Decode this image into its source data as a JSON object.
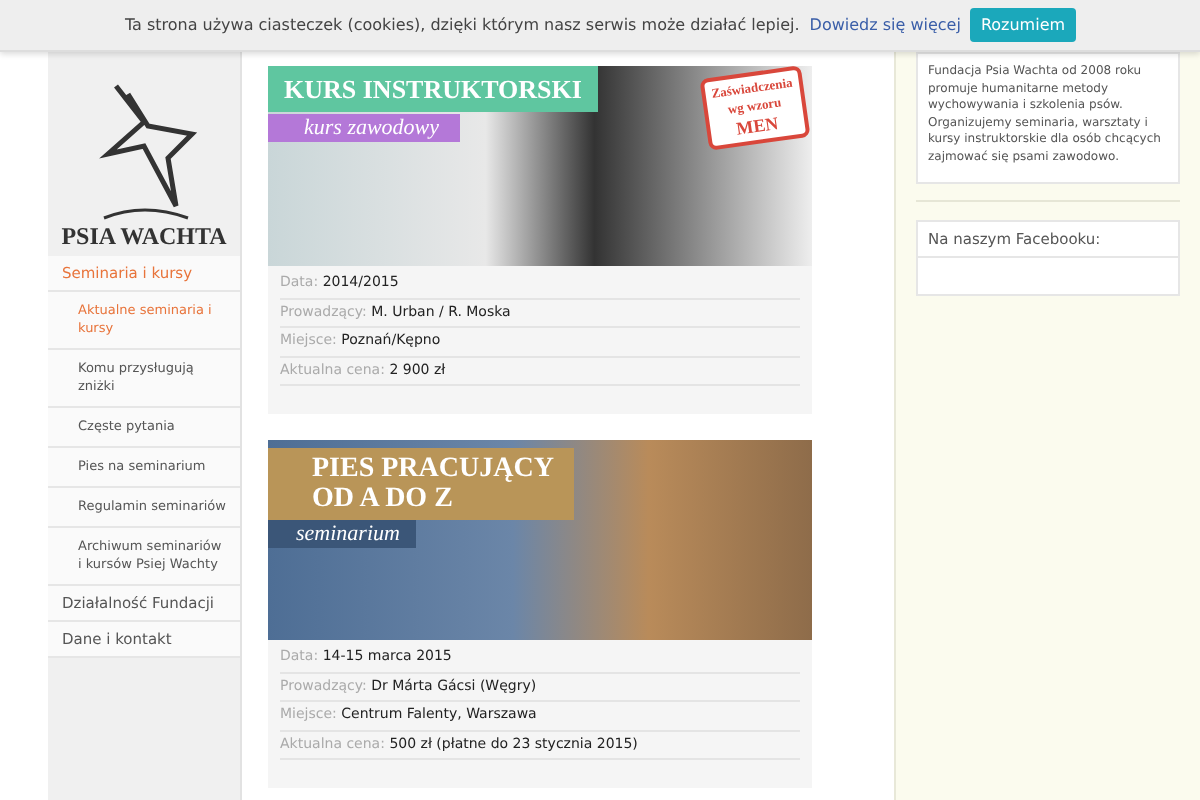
{
  "cookie_bar": {
    "text": "Ta strona używa ciasteczek (cookies), dzięki którym nasz serwis może działać lepiej.",
    "link": "Dowiedz się więcej",
    "button": "Rozumiem"
  },
  "logo": {
    "text": "PSIA WACHTA"
  },
  "sidebar": {
    "items": [
      {
        "label": "Seminaria i kursy",
        "selected": true,
        "children": [
          {
            "label": "Aktualne seminaria i kursy",
            "selected": true
          },
          {
            "label": "Komu przysługują zniżki",
            "selected": false
          },
          {
            "label": "Częste pytania",
            "selected": false
          },
          {
            "label": "Pies na seminarium",
            "selected": false
          },
          {
            "label": "Regulamin seminariów",
            "selected": false
          },
          {
            "label": "Archiwum seminariów i kursów Psiej Wachty",
            "selected": false
          }
        ]
      },
      {
        "label": "Działalność Fundacji",
        "selected": false
      },
      {
        "label": "Dane i kontakt",
        "selected": false
      }
    ]
  },
  "events": [
    {
      "banner": {
        "kind": "course",
        "title": "KURS INSTRUKTORSKI",
        "subtitle": "kurs zawodowy",
        "stamp": [
          "Zaświadczenia",
          "wg wzoru",
          "MEN"
        ]
      },
      "fields": [
        {
          "label": "Data:",
          "value": "2014/2015"
        },
        {
          "label": "Prowadzący:",
          "value": "M. Urban / R. Moska"
        },
        {
          "label": "Miejsce:",
          "value": "Poznań/Kępno"
        },
        {
          "label": "Aktualna cena:",
          "value": "2 900 zł"
        }
      ]
    },
    {
      "banner": {
        "kind": "seminar",
        "title": "PIES PRACUJĄCY",
        "title2": "OD A DO Z",
        "subtitle": "seminarium"
      },
      "fields": [
        {
          "label": "Data:",
          "value": "14-15 marca 2015"
        },
        {
          "label": "Prowadzący:",
          "value": "Dr Márta Gácsi (Węgry)"
        },
        {
          "label": "Miejsce:",
          "value": "Centrum Falenty, Warszawa"
        },
        {
          "label": "Aktualna cena:",
          "value": "500 zł (płatne do 23 stycznia 2015)"
        }
      ]
    }
  ],
  "right": {
    "about": "Fundacja Psia Wachta od 2008 roku promuje humanitarne metody wychowywania i szkolenia psów. Organizujemy seminaria, warsztaty i kursy instruktorskie dla osób chcących zajmować się psami zawodowo.",
    "facebook_title": "Na naszym Facebooku:"
  }
}
